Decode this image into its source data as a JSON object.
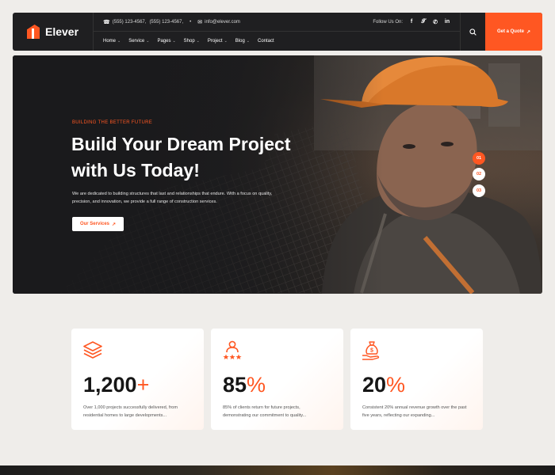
{
  "brand": {
    "name": "Elever"
  },
  "topbar": {
    "phone1": "(555) 123-4567,",
    "phone2": "(555) 123-4567,",
    "email": "info@elever.com",
    "follow_label": "Follow Us On:",
    "socials": [
      "f",
      "t",
      "w",
      "in"
    ]
  },
  "nav": {
    "items": [
      {
        "label": "Home"
      },
      {
        "label": "Service"
      },
      {
        "label": "Pages"
      },
      {
        "label": "Shop"
      },
      {
        "label": "Project"
      },
      {
        "label": "Blog"
      },
      {
        "label": "Contact"
      }
    ],
    "cta": "Get a Quote"
  },
  "hero": {
    "eyebrow": "BUILDING THE BETTER FUTURE",
    "title_line1": "Build Your Dream Project",
    "title_line2": "with Us Today!",
    "desc_line1": "We are dedicated to building structures that last and relationships that endure. With a focus on quality,",
    "desc_line2": "precision, and innovation, we provide a full range of construction services.",
    "button": "Our Services",
    "slides": [
      "01",
      "02",
      "03"
    ]
  },
  "stats": [
    {
      "number": "1,200",
      "suffix": "+",
      "icon": "layers-icon",
      "line1": "Over 1,000 projects successfully delivered, from",
      "line2": "residential homes to large developments..."
    },
    {
      "number": "85",
      "suffix": "%",
      "icon": "client-rating-icon",
      "line1": "85% of clients return for future projects,",
      "line2": "demonstrating our commitment to quality..."
    },
    {
      "number": "20",
      "suffix": "%",
      "icon": "money-bag-icon",
      "line1": "Consistent 20% annual revenue growth over the past",
      "line2": "five years, reflecting our expanding..."
    }
  ],
  "colors": {
    "accent": "#ff5722",
    "dark": "#1f1f21",
    "page_bg": "#efedea"
  }
}
